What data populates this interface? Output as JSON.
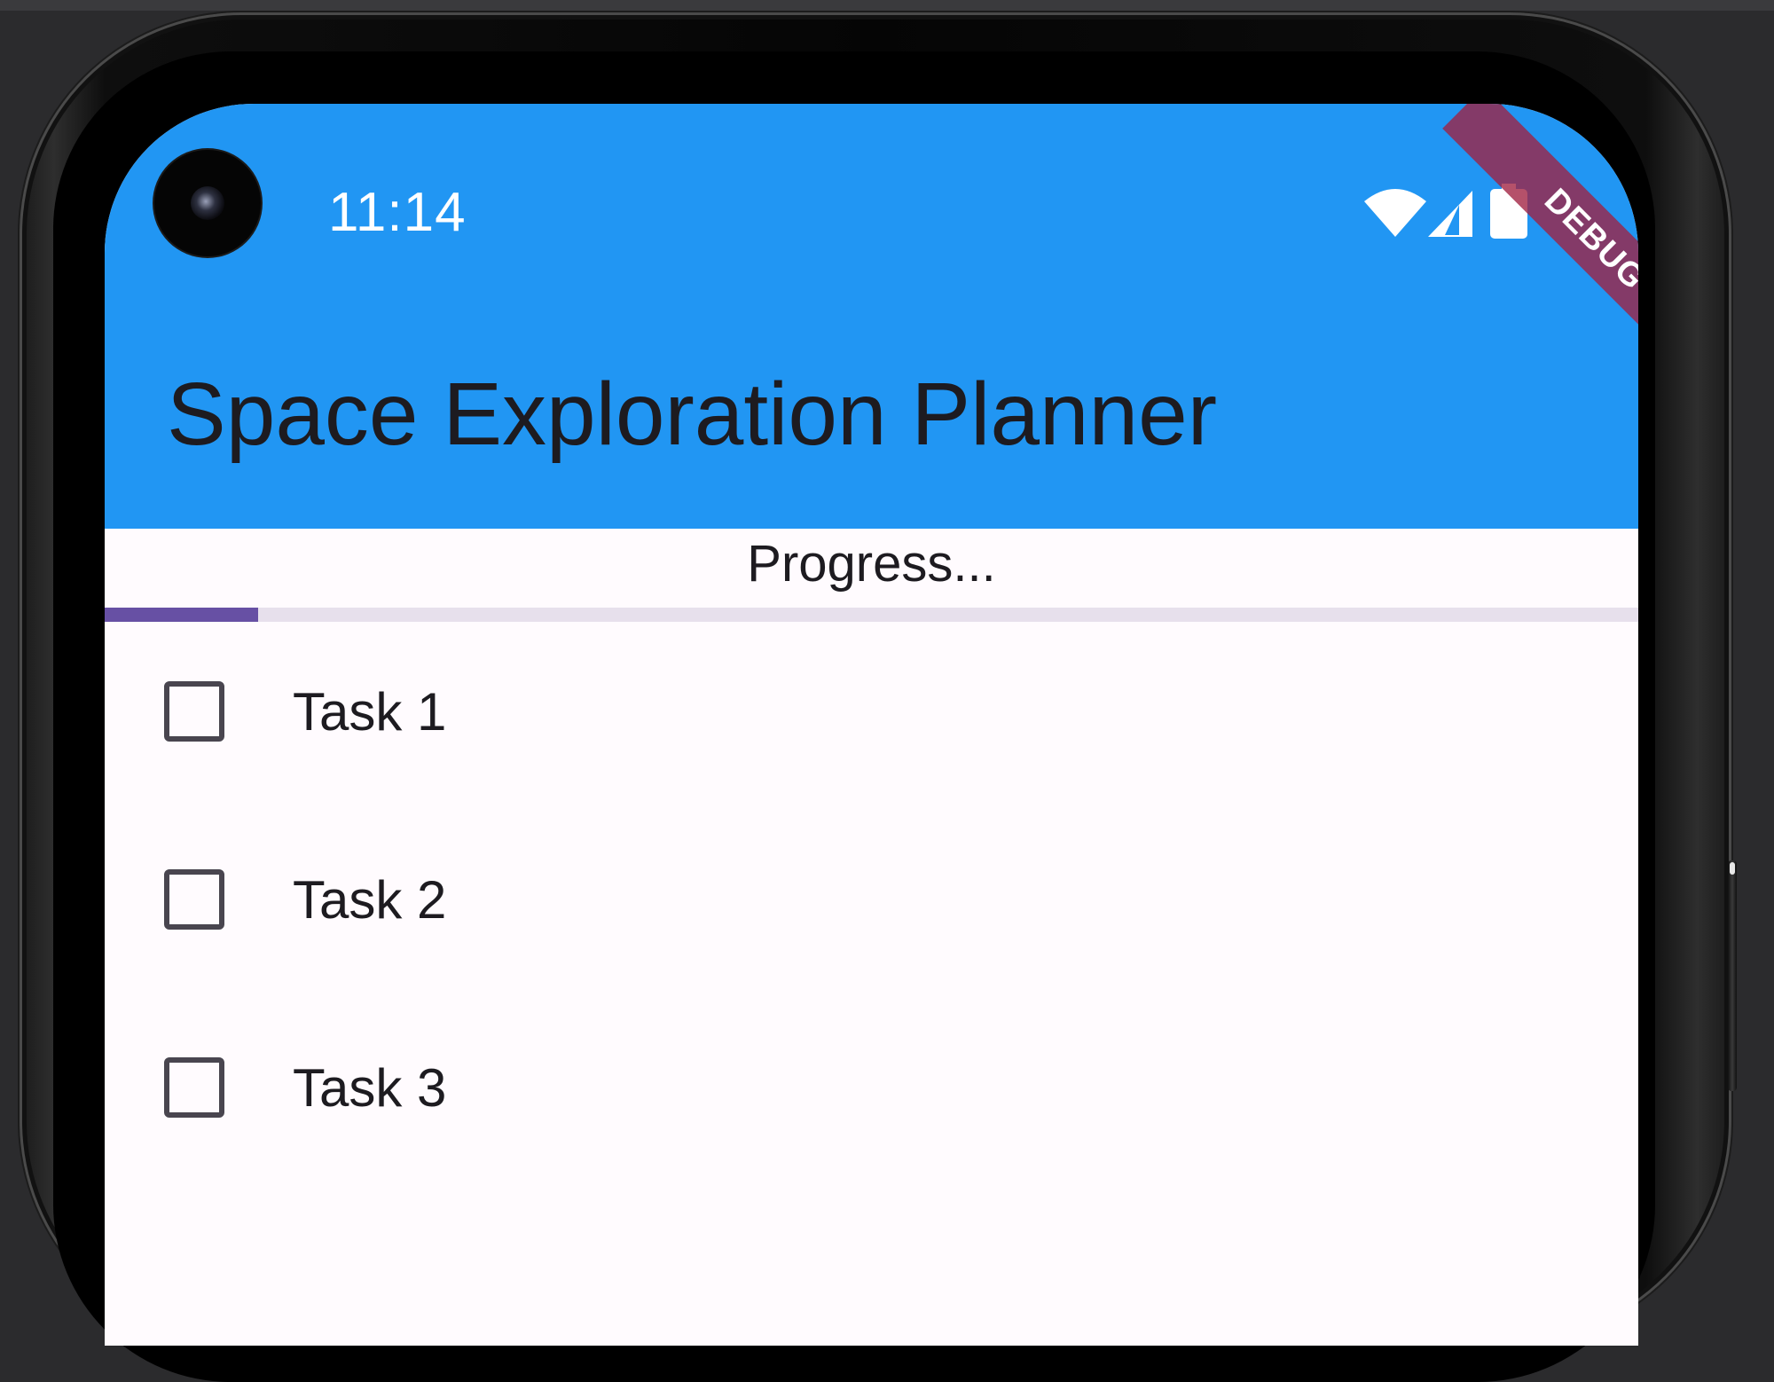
{
  "status_bar": {
    "time": "11:14",
    "icons": [
      "wifi-icon",
      "cell-signal-icon",
      "battery-icon"
    ]
  },
  "debug_banner": "DEBUG",
  "app_bar": {
    "title": "Space Exploration Planner",
    "background_color": "#2196f3"
  },
  "progress": {
    "label": "Progress...",
    "value": 0.1,
    "fill_color": "#6750a4",
    "track_color": "#e7e0ec"
  },
  "tasks": [
    {
      "label": "Task 1",
      "checked": false
    },
    {
      "label": "Task 2",
      "checked": false
    },
    {
      "label": "Task 3",
      "checked": false
    }
  ]
}
